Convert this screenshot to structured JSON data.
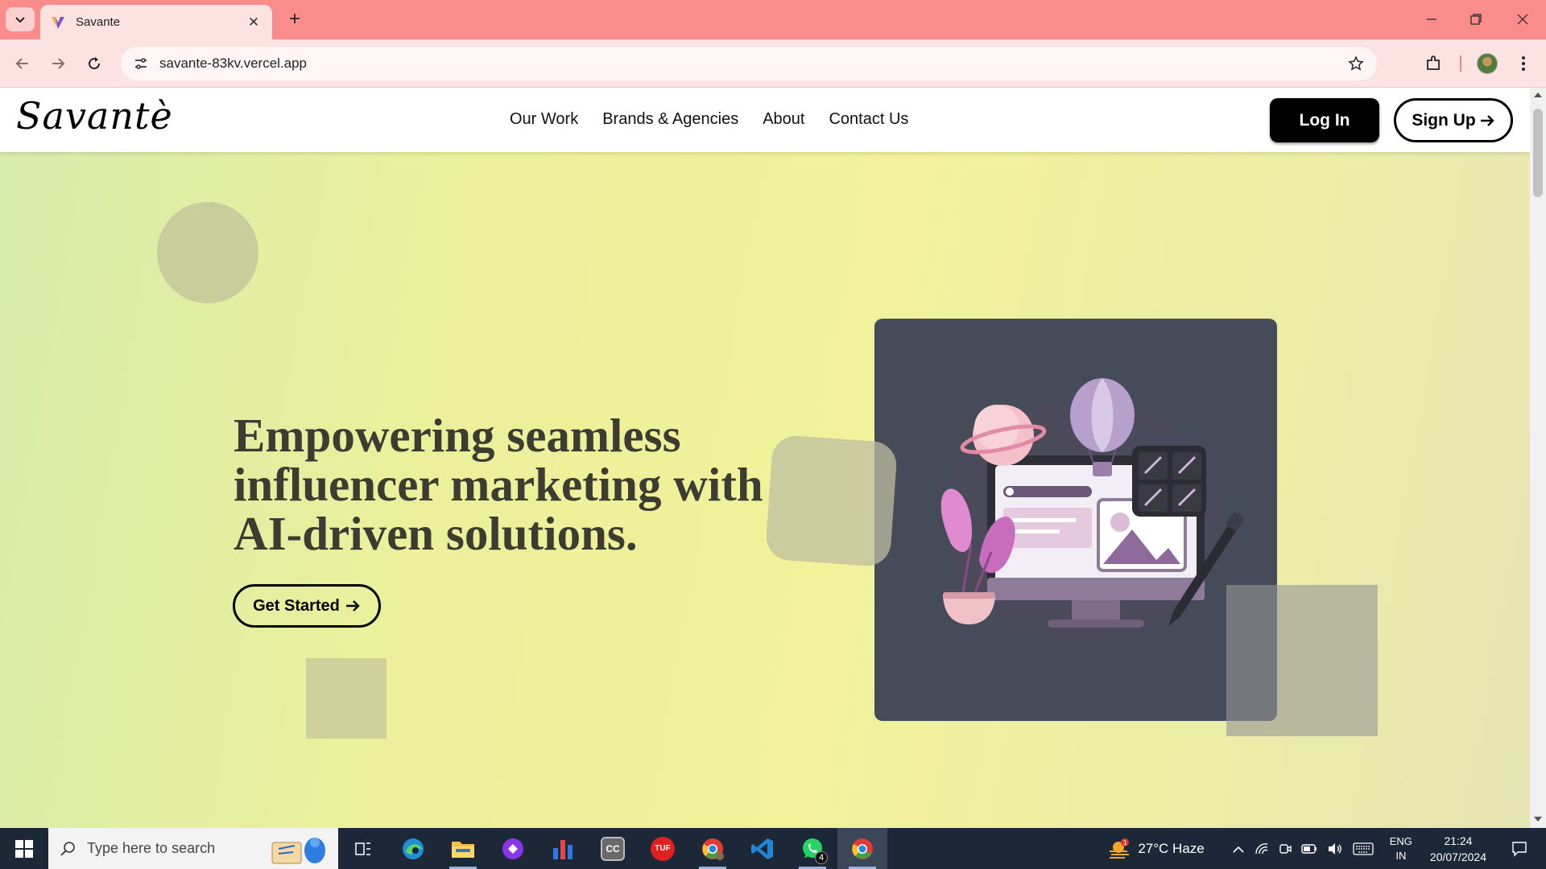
{
  "browser": {
    "tab_title": "Savante",
    "url": "savante-83kv.vercel.app",
    "accent": "#fb8c8c"
  },
  "site": {
    "logo": "Savantè",
    "nav": [
      "Our Work",
      "Brands & Agencies",
      "About",
      "Contact Us"
    ],
    "login_label": "Log In",
    "signup_label": "Sign Up",
    "hero_title": "Empowering seamless influencer marketing with AI-driven solutions.",
    "cta_label": "Get Started"
  },
  "taskbar": {
    "search_placeholder": "Type here to search",
    "weather": "27°C  Haze",
    "weather_alert": "1",
    "lang_1": "ENG",
    "lang_2": "IN",
    "time": "21:24",
    "date": "20/07/2024",
    "whatsapp_badge": "4",
    "apps": [
      "task-view",
      "edge",
      "file-explorer",
      "copilot",
      "charts",
      "cc",
      "tuf",
      "chrome-profile",
      "vscode",
      "whatsapp",
      "chrome"
    ]
  }
}
